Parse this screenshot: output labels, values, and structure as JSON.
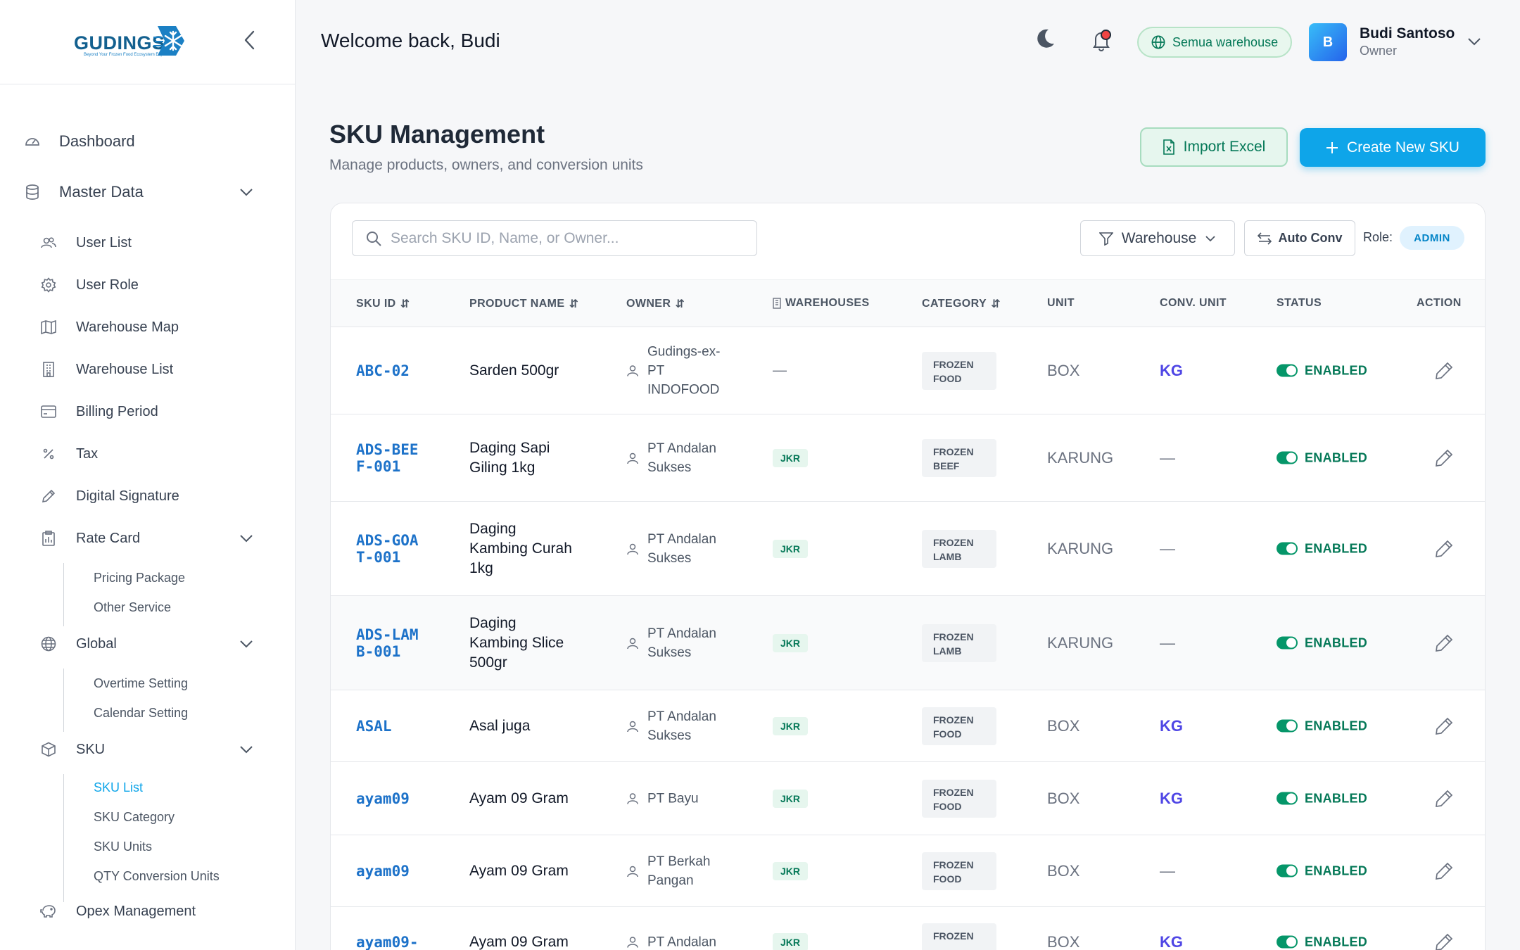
{
  "brand": {
    "logo_text": "GUDINGS",
    "tagline": "Beyond Your Frozen Food Ecosystem Expert"
  },
  "header": {
    "welcome": "Welcome back, Budi",
    "warehouse_pill": "Semua warehouse",
    "user": {
      "initial": "B",
      "name": "Budi Santoso",
      "role": "Owner"
    }
  },
  "sidebar": {
    "dashboard": "Dashboard",
    "master_data": "Master Data",
    "user_list": "User List",
    "user_role": "User Role",
    "warehouse_map": "Warehouse Map",
    "warehouse_list": "Warehouse List",
    "billing_period": "Billing Period",
    "tax": "Tax",
    "digital_signature": "Digital Signature",
    "rate_card": "Rate Card",
    "pricing_package": "Pricing Package",
    "other_service": "Other Service",
    "global": "Global",
    "overtime_setting": "Overtime Setting",
    "calendar_setting": "Calendar Setting",
    "sku": "SKU",
    "sku_list": "SKU List",
    "sku_category": "SKU Category",
    "sku_units": "SKU Units",
    "qty_conversion_units": "QTY Conversion Units",
    "opex_management": "Opex Management"
  },
  "page": {
    "title": "SKU Management",
    "subtitle": "Manage products, owners, and conversion units",
    "import_label": "Import Excel",
    "create_label": "Create New SKU"
  },
  "toolbar": {
    "search_placeholder": "Search SKU ID, Name, or Owner...",
    "warehouse_filter": "Warehouse",
    "auto_conv": "Auto Conv",
    "role_label": "Role:",
    "role_value": "ADMIN"
  },
  "table": {
    "headers": {
      "sku_id": "SKU ID",
      "product_name": "PRODUCT NAME",
      "owner": "OWNER",
      "warehouses": "WAREHOUSES",
      "category": "CATEGORY",
      "unit": "UNIT",
      "conv_unit": "CONV. UNIT",
      "status": "STATUS",
      "action": "ACTION"
    },
    "rows": [
      {
        "sku": "ABC-02",
        "name": "Sarden 500gr",
        "owner": "Gudings-ex-PT INDOFOOD",
        "warehouse": "—",
        "category": "FROZEN FOOD",
        "unit": "BOX",
        "conv": "KG",
        "status": "ENABLED"
      },
      {
        "sku": "ADS-BEEF-001",
        "name": "Daging Sapi Giling 1kg",
        "owner": "PT Andalan Sukses",
        "warehouse": "JKR",
        "category": "FROZEN BEEF",
        "unit": "KARUNG",
        "conv": "—",
        "status": "ENABLED"
      },
      {
        "sku": "ADS-GOAT-001",
        "name": "Daging Kambing Curah 1kg",
        "owner": "PT Andalan Sukses",
        "warehouse": "JKR",
        "category": "FROZEN LAMB",
        "unit": "KARUNG",
        "conv": "—",
        "status": "ENABLED"
      },
      {
        "sku": "ADS-LAMB-001",
        "name": "Daging Kambing Slice 500gr",
        "owner": "PT Andalan Sukses",
        "warehouse": "JKR",
        "category": "FROZEN LAMB",
        "unit": "KARUNG",
        "conv": "—",
        "status": "ENABLED"
      },
      {
        "sku": "ASAL",
        "name": "Asal juga",
        "owner": "PT Andalan Sukses",
        "warehouse": "JKR",
        "category": "FROZEN FOOD",
        "unit": "BOX",
        "conv": "KG",
        "status": "ENABLED"
      },
      {
        "sku": "ayam09",
        "name": "Ayam 09 Gram",
        "owner": "PT Bayu",
        "warehouse": "JKR",
        "category": "FROZEN FOOD",
        "unit": "BOX",
        "conv": "KG",
        "status": "ENABLED"
      },
      {
        "sku": "ayam09",
        "name": "Ayam 09 Gram",
        "owner": "PT Berkah Pangan",
        "warehouse": "JKR",
        "category": "FROZEN FOOD",
        "unit": "BOX",
        "conv": "—",
        "status": "ENABLED"
      },
      {
        "sku": "ayam09-",
        "name": "Ayam 09 Gram",
        "owner": "PT Andalan",
        "warehouse": "JKR",
        "category": "FROZEN",
        "unit": "BOX",
        "conv": "KG",
        "status": "ENABLED"
      }
    ]
  },
  "colors": {
    "accent": "#0ea5e9",
    "sku_link": "#1d72c9",
    "status_green": "#047857",
    "conv_unit": "#4f46e5"
  }
}
